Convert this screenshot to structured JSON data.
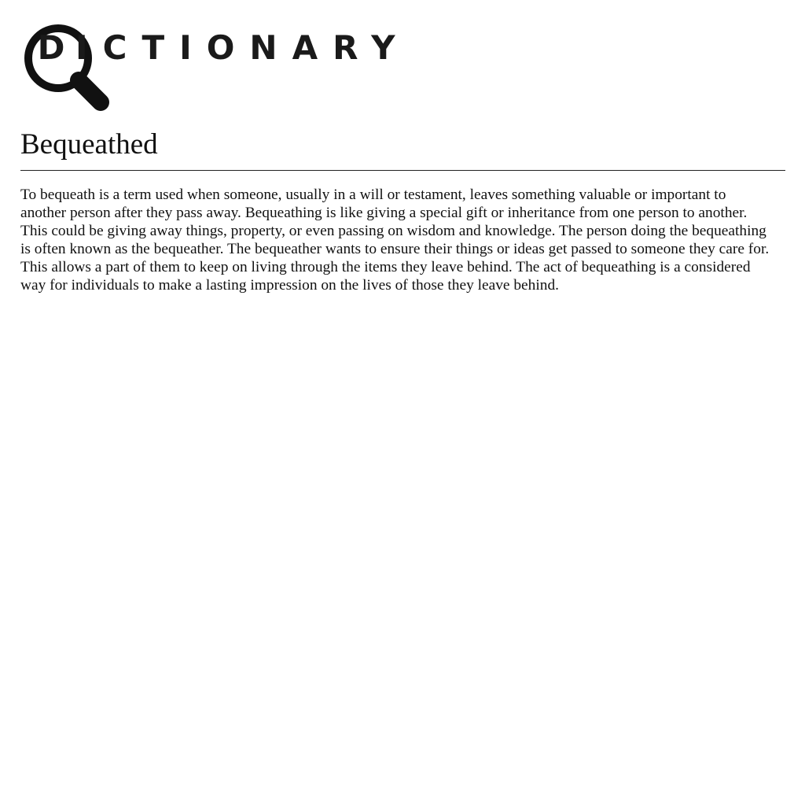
{
  "logo": {
    "letter_first": "D",
    "letters_rest": "ICTIONARY",
    "icon": "magnifying-glass-icon"
  },
  "entry": {
    "word": "Bequeathed",
    "definition": "To bequeath is a term used when someone, usually in a will or testament, leaves something valuable or important to another person after they pass away. Bequeathing is like giving a special gift or inheritance from one person to another. This could be giving away things, property, or even passing on wisdom and knowledge. The person doing the bequeathing is often known as the bequeather. The bequeather wants to ensure their things or ideas get passed to someone they care for. This allows a part of them to keep on living through the items they leave behind. The act of bequeathing is a considered way for individuals to make a lasting impression on the lives of those they leave behind."
  }
}
